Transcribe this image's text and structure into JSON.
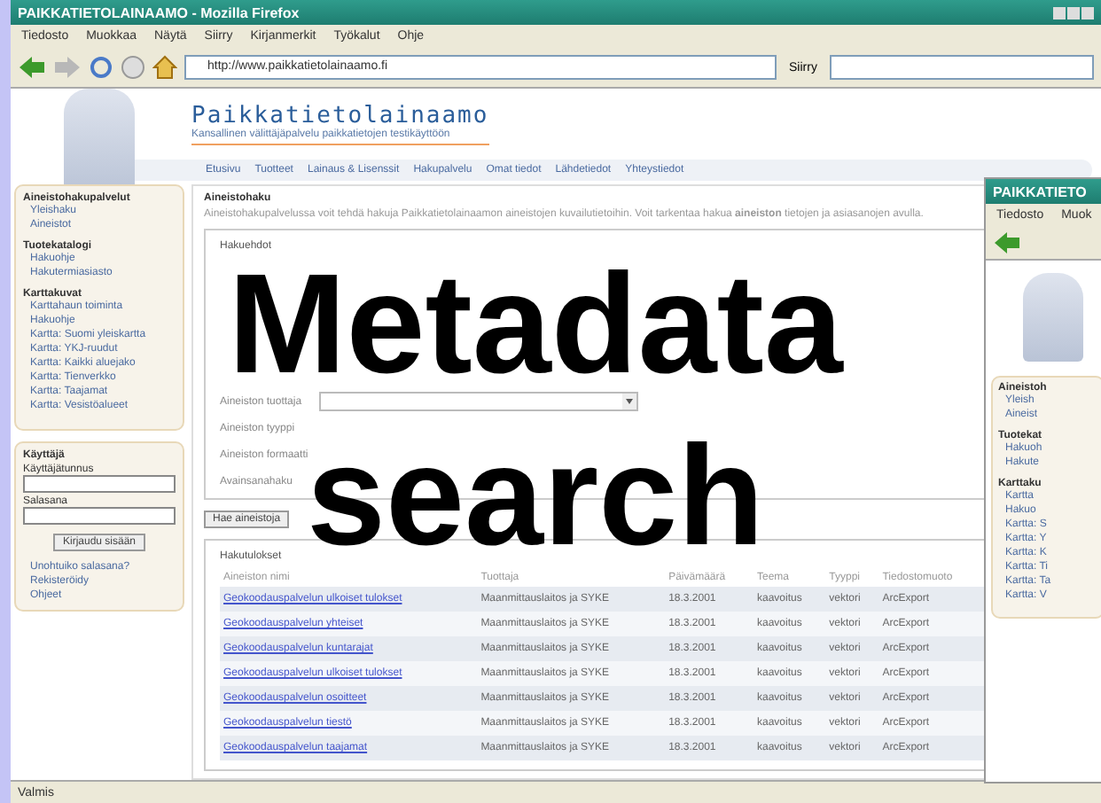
{
  "window": {
    "title": "PAIKKATIETOLAINAAMO - Mozilla Firefox"
  },
  "menu": [
    "Tiedosto",
    "Muokkaa",
    "Näytä",
    "Siirry",
    "Kirjanmerkit",
    "Työkalut",
    "Ohje"
  ],
  "toolbar": {
    "url": "http://www.paikkatietolainaamo.fi",
    "go": "Siirry"
  },
  "site": {
    "logo": "Paikkatietolainaamo",
    "tagline": "Kansallinen välittäjäpalvelu paikkatietojen testikäyttöön",
    "nav": [
      "Etusivu",
      "Tuotteet",
      "Lainaus & Lisenssit",
      "Hakupalvelu",
      "Omat tiedot",
      "Lähdetiedot",
      "Yhteystiedot"
    ]
  },
  "sidebar": {
    "sections": [
      {
        "heading": "Aineistohakupalvelut",
        "items": [
          "Yleishaku",
          "Aineistot"
        ]
      },
      {
        "heading": "Tuotekatalogi",
        "items": [
          "Hakuohje",
          "Hakutermiasiasto"
        ]
      },
      {
        "heading": "Karttakuvat",
        "items": [
          "Karttahaun toiminta",
          "Hakuohje",
          "Kartta: Suomi yleiskartta",
          "Kartta: YKJ-ruudut",
          "Kartta: Kaikki aluejako",
          "Kartta: Tienverkko",
          "Kartta: Taajamat",
          "Kartta: Vesistöalueet"
        ]
      }
    ],
    "login": {
      "heading": "Käyttäjä",
      "user_label": "Käyttäjätunnus",
      "password_label": "Salasana",
      "button": "Kirjaudu sisään",
      "links": [
        "Unohtuiko salasana?",
        "Rekisteröidy",
        "Ohjeet"
      ]
    }
  },
  "main": {
    "heading": "Aineistohaku",
    "intro": "Aineistohakupalvelussa voit tehdä hakuja Paikkatietolainaamon aineistojen kuvailutietoihin. Voit tarkentaa hakua **aineiston** tietojen ja asiasanojen avulla.",
    "criteria": {
      "legend": "Hakuehdot",
      "fields": [
        {
          "label": "Aineiston tuottaja",
          "kind": "select"
        },
        {
          "label": "Aineiston tyyppi"
        },
        {
          "label": "Aineiston formaatti"
        },
        {
          "label": "Avainsanahaku"
        }
      ],
      "button": "Hae aineistoja"
    },
    "results": {
      "legend": "Hakutulokset",
      "columns": [
        "Aineiston nimi",
        "Tuottaja",
        "Päivämäärä",
        "Teema",
        "Tyyppi",
        "Tiedostomuoto"
      ],
      "rows": [
        [
          "Geokoodauspalvelun ulkoiset tulokset",
          "Maanmittauslaitos ja SYKE",
          "18.3.2001",
          "kaavoitus",
          "vektori",
          "ArcExport"
        ],
        [
          "Geokoodauspalvelun yhteiset",
          "Maanmittauslaitos ja SYKE",
          "18.3.2001",
          "kaavoitus",
          "vektori",
          "ArcExport"
        ],
        [
          "Geokoodauspalvelun kuntarajat",
          "Maanmittauslaitos ja SYKE",
          "18.3.2001",
          "kaavoitus",
          "vektori",
          "ArcExport"
        ],
        [
          "Geokoodauspalvelun ulkoiset tulokset",
          "Maanmittauslaitos ja SYKE",
          "18.3.2001",
          "kaavoitus",
          "vektori",
          "ArcExport"
        ],
        [
          "Geokoodauspalvelun osoitteet",
          "Maanmittauslaitos ja SYKE",
          "18.3.2001",
          "kaavoitus",
          "vektori",
          "ArcExport"
        ],
        [
          "Geokoodauspalvelun tiestö",
          "Maanmittauslaitos ja SYKE",
          "18.3.2001",
          "kaavoitus",
          "vektori",
          "ArcExport"
        ],
        [
          "Geokoodauspalvelun taajamat",
          "Maanmittauslaitos ja SYKE",
          "18.3.2001",
          "kaavoitus",
          "vektori",
          "ArcExport"
        ]
      ]
    }
  },
  "status_bar": "Valmis",
  "second_window": {
    "title": "PAIKKATIETO",
    "menu": [
      "Tiedosto",
      "Muok"
    ],
    "sidebar": [
      {
        "heading": "Aineistoh",
        "items": [
          "Yleish",
          "Aineist"
        ]
      },
      {
        "heading": "Tuotekat",
        "items": [
          "Hakuoh",
          "Hakute"
        ]
      },
      {
        "heading": "Karttaku",
        "items": [
          "Kartta",
          "Hakuo",
          "Kartta: S",
          "Kartta: Y",
          "Kartta: K",
          "Kartta: Ti",
          "Kartta: Ta",
          "Kartta: V"
        ]
      }
    ]
  },
  "overlay": {
    "title": [
      "Metadata",
      "search"
    ]
  }
}
